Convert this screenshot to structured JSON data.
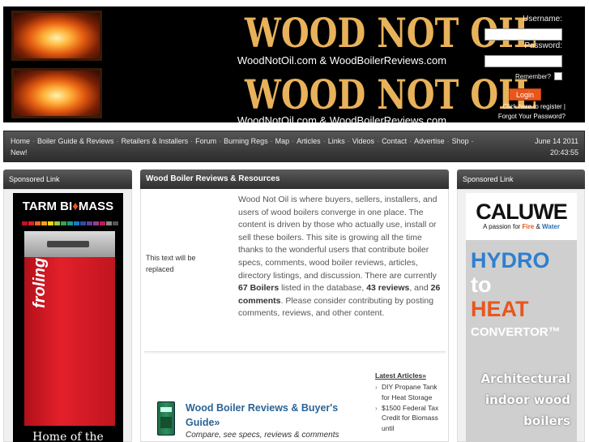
{
  "header": {
    "site_title": "WOOD NOT OIL",
    "site_subtitle": "WoodNotOil.com & WoodBoilerReviews.com",
    "login": {
      "username_label": "Username:",
      "password_label": "Password:",
      "remember_label": "Remember?",
      "login_button": "Login",
      "register_link": "Click here to register |",
      "forgot_link": "Forgot Your Password?"
    }
  },
  "nav": {
    "items": [
      "Home",
      "Boiler Guide & Reviews",
      "Retailers & Installers",
      "Forum",
      "Burning Regs",
      "Map",
      "Articles",
      "Links",
      "Videos",
      "Contact",
      "Advertise",
      "Shop",
      "New!"
    ],
    "date": "June 14 2011",
    "time": "20:43:55"
  },
  "left_column": {
    "heading": "Sponsored Link",
    "ad": {
      "brand": "TARM BI",
      "brand_suffix": "MASS",
      "product_name": "froling",
      "caption": "Home of the"
    }
  },
  "center_column": {
    "heading": "Wood Boiler Reviews & Resources",
    "placeholder_text": "This text will be replaced",
    "intro_part1": "Wood Not Oil is where buyers, sellers, installers, and users of wood boilers converge in one place. The content is driven by those who actually use, install or sell these boilers. This site is growing all the time thanks to the wonderful users that contribute boiler specs, comments, wood boiler reviews, articles, directory listings, and discussion. There are currently ",
    "boilers_count": "67 Boilers",
    "intro_part2": " listed in the database, ",
    "reviews_count": "43 reviews",
    "intro_part3": ", and ",
    "comments_count": "26 comments",
    "intro_part4": ". Please consider contributing by posting comments, reviews, and other content.",
    "guide_title": "Wood Boiler Reviews & Buyer's Guide»",
    "guide_subtitle": "Compare, see specs, reviews & comments",
    "latest_articles_title": "Latest Articles»",
    "latest_articles": [
      "DIY Propane Tank for Heat Storage",
      "$1500 Federal Tax Credit for Biomass until"
    ]
  },
  "right_column": {
    "heading": "Sponsored Link",
    "ad": {
      "logo": "CALUWE",
      "tagline_prefix": "A passion for ",
      "tagline_fire": "Fire",
      "tagline_mid": " & ",
      "tagline_water": "Water",
      "line1": "HYDRO",
      "line2": "to",
      "line3": "HEAT",
      "line4": "CONVERTOR™",
      "description": "Architectural indoor wood boilers"
    }
  },
  "colors": {
    "accent_orange": "#e8561c",
    "title_gold": "#e8b25a",
    "link_blue": "#2a6496"
  }
}
